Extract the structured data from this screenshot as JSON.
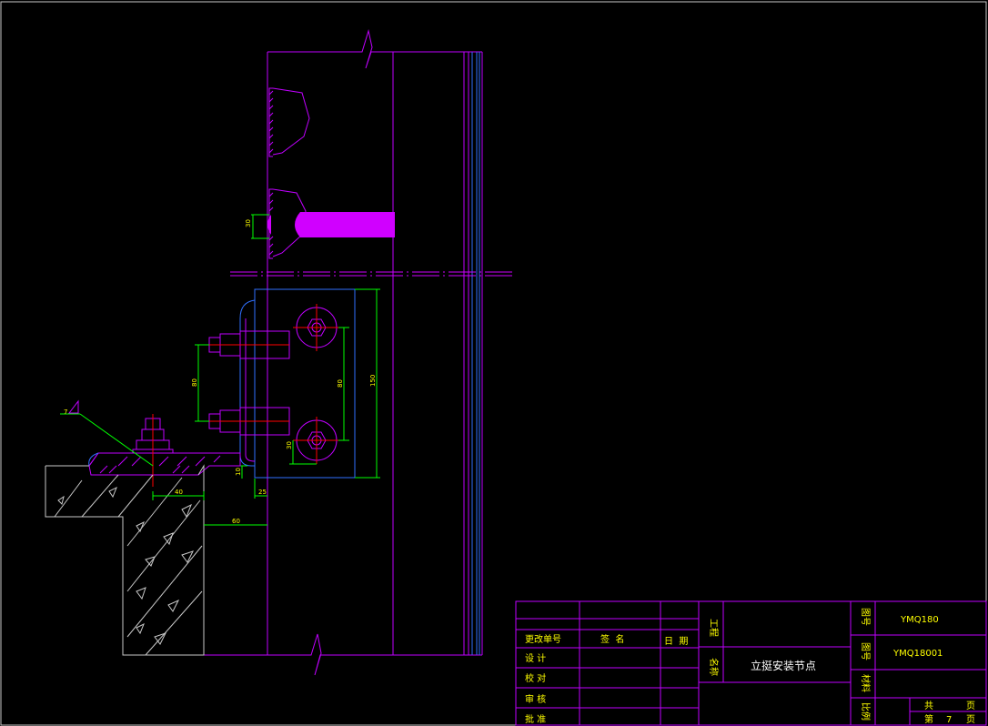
{
  "dimensions": {
    "d30_top": "30",
    "d80_left": "80",
    "d80_inner": "80",
    "d150": "150",
    "d30_low": "30",
    "d10": "10",
    "d40": "40",
    "d25": "25",
    "d60": "60"
  },
  "weld_symbol": "7",
  "title_block": {
    "change_no": "更改单号",
    "signature": "签  名",
    "date": "日  期",
    "design": "设  计",
    "check": "校  对",
    "review": "审  核",
    "approve": "批  准",
    "project_label": "工程",
    "name_label": "名称",
    "drawing_title": "立挺安装节点",
    "catalog_label": "图号",
    "catalog_value": "YMQ180",
    "drawing_no_label": "图号",
    "drawing_no_value": "YMQ18001",
    "material_label": "材料",
    "scale_label": "比例",
    "total_label": "共",
    "page_unit": "页",
    "sheet_label": "第",
    "sheet_no": "7",
    "sheet_unit": "页"
  }
}
